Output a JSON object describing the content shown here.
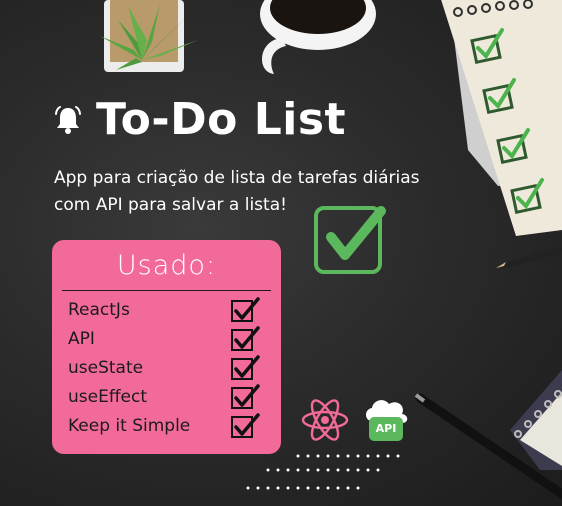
{
  "title": "To-Do List",
  "subtitle": {
    "line1": "App para criação de lista de tarefas diárias",
    "line2": "com API para salvar a lista!"
  },
  "card": {
    "title": "Usado:",
    "items": [
      {
        "label": "ReactJs",
        "checked": true
      },
      {
        "label": "API",
        "checked": true
      },
      {
        "label": "useState",
        "checked": true
      },
      {
        "label": "useEffect",
        "checked": true
      },
      {
        "label": "Keep it Simple",
        "checked": true
      }
    ]
  },
  "badges": {
    "api_label": "API"
  },
  "icons": {
    "title": "bell-icon",
    "big_check": "checkmark-icon",
    "react": "react-logo-icon",
    "api": "cloud-api-icon"
  },
  "colors": {
    "card": "#f26a9a",
    "accent_green": "#5cb85c",
    "background": "#2b2b2b",
    "text": "#ffffff"
  }
}
